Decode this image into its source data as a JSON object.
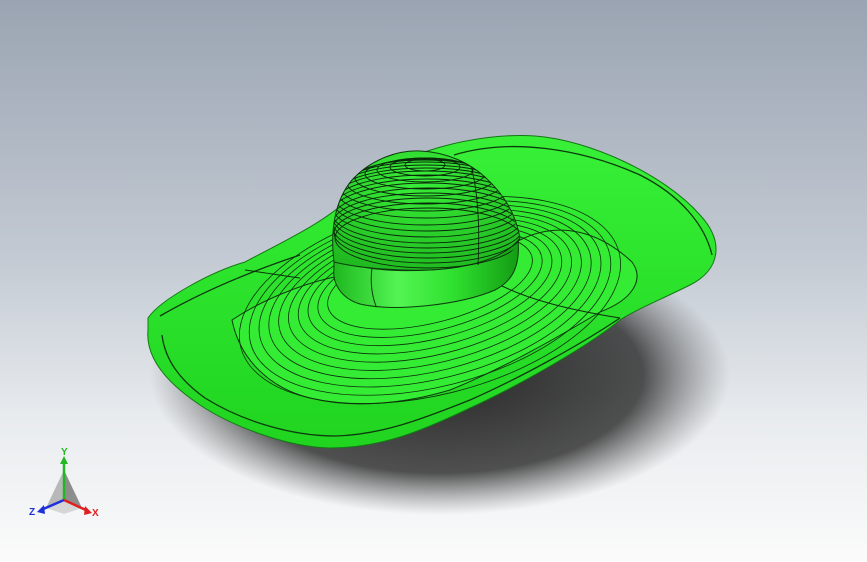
{
  "viewport": {
    "background_top": "#9aa4b2",
    "background_bottom": "#fbfbfb"
  },
  "model": {
    "name": "hat",
    "color": "#2ee62e",
    "edge_color": "#0a2a0a",
    "shadow_color": "#2b2b2b"
  },
  "triad": {
    "x_label": "X",
    "y_label": "Y",
    "z_label": "Z",
    "x_color": "#e02020",
    "y_color": "#22b822",
    "z_color": "#2030d8"
  }
}
